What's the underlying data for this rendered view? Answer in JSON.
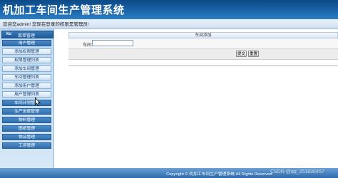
{
  "app": {
    "title": "机加工车间生产管理系统"
  },
  "welcome": {
    "text": "欢迎您admin! 您现在登录的权限是管理员!"
  },
  "sidebar": {
    "header_icon": "ku",
    "header_label": "菜单管理",
    "items": [
      {
        "label": "用户管理",
        "type": "section"
      },
      {
        "label": "添加权限管理",
        "type": "link"
      },
      {
        "label": "权限管理列表",
        "type": "link"
      },
      {
        "label": "添加车间管理",
        "type": "link"
      },
      {
        "label": "车间管理列表",
        "type": "link"
      },
      {
        "label": "添加用户管理",
        "type": "link"
      },
      {
        "label": "用户管理列表",
        "type": "link"
      },
      {
        "label": "车间计划管理",
        "type": "section"
      },
      {
        "label": "生产进度管理",
        "type": "section"
      },
      {
        "label": "物料管理",
        "type": "section"
      },
      {
        "label": "图纸管理",
        "type": "section"
      },
      {
        "label": "物品管理",
        "type": "section"
      },
      {
        "label": "工序管理",
        "type": "section"
      }
    ]
  },
  "main": {
    "panel_title": "车间添加",
    "field_label": "车间:",
    "field_value": "",
    "submit_label": "提交",
    "reset_label": "重置"
  },
  "footer": {
    "copyright": "Copyright © 机加工车间生产管理系统 All Rights Reserved",
    "watermark": "CSDN @qq_251836457"
  },
  "colors": {
    "header": "#1a64aa",
    "sidebar_bg": "#c8dff4",
    "section_item": "#2f6eae",
    "footer": "#2d6aab"
  }
}
